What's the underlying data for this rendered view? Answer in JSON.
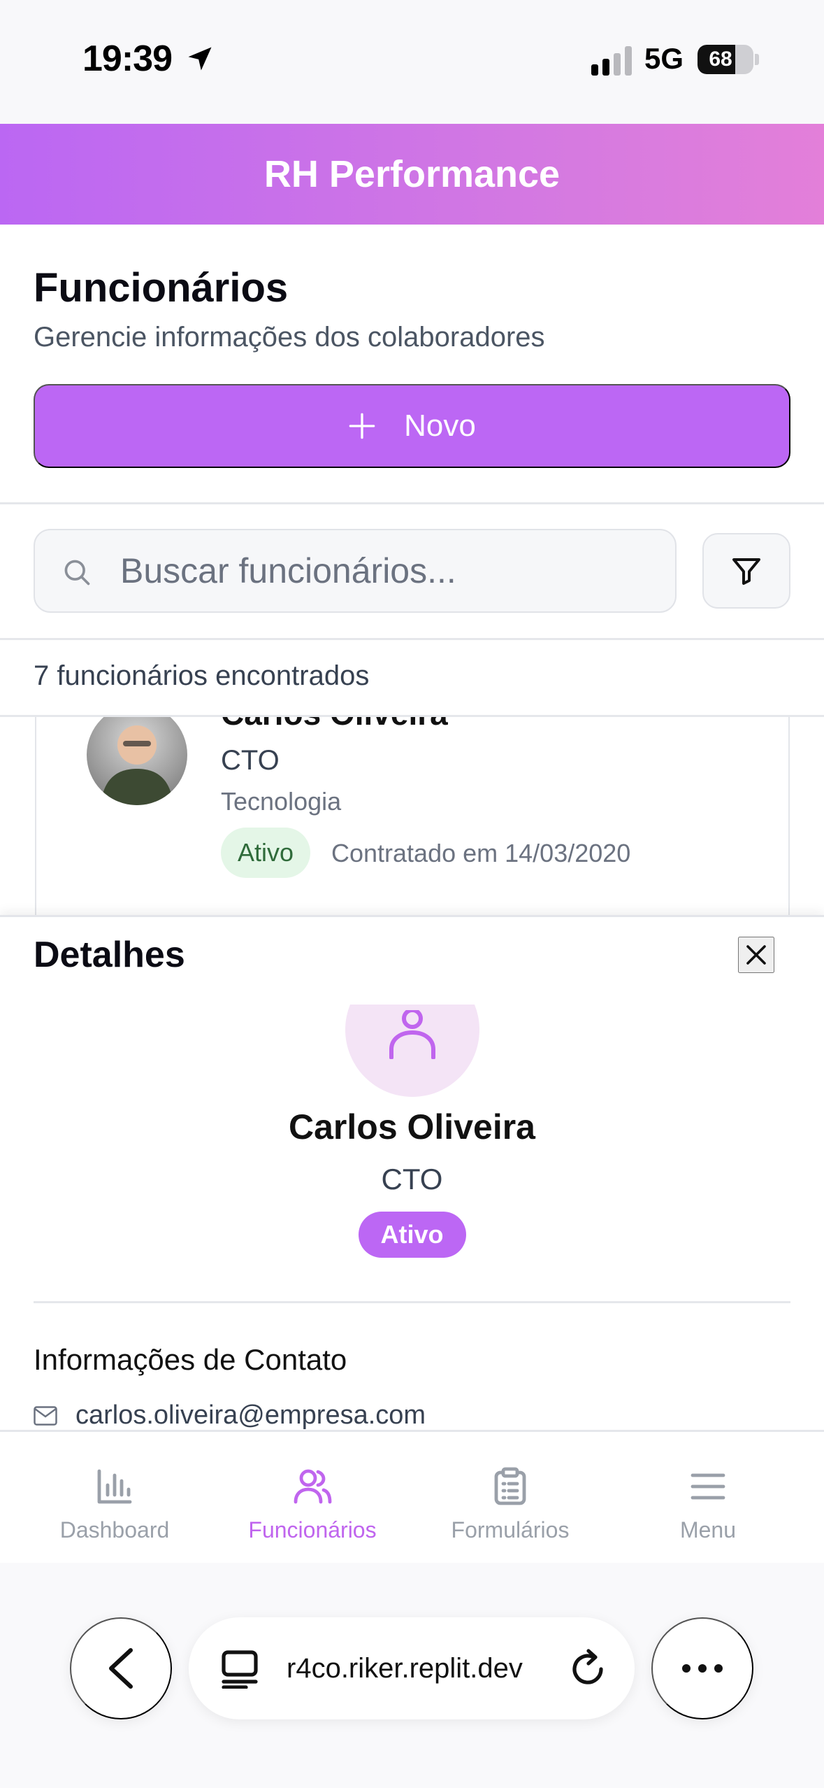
{
  "status_bar": {
    "time": "19:39",
    "network": "5G",
    "battery": "68",
    "battery_level": 0.68
  },
  "app": {
    "title": "RH Performance"
  },
  "page": {
    "title": "Funcionários",
    "subtitle": "Gerencie informações dos colaboradores",
    "new_button_label": "Novo"
  },
  "search": {
    "placeholder": "Buscar funcionários..."
  },
  "results": {
    "count_text": "7 funcionários encontrados"
  },
  "employee_card": {
    "name": "Carlos Oliveira",
    "role": "CTO",
    "department": "Tecnologia",
    "status": "Ativo",
    "hired": "Contratado em 14/03/2020"
  },
  "details": {
    "title": "Detalhes",
    "name": "Carlos Oliveira",
    "role": "CTO",
    "status": "Ativo",
    "contact_heading": "Informações de Contato",
    "email": "carlos.oliveira@empresa.com"
  },
  "tabs": [
    {
      "label": "Dashboard",
      "icon": "bar-chart-icon",
      "active": false
    },
    {
      "label": "Funcionários",
      "icon": "users-icon",
      "active": true
    },
    {
      "label": "Formulários",
      "icon": "clipboard-icon",
      "active": false
    },
    {
      "label": "Menu",
      "icon": "menu-icon",
      "active": false
    }
  ],
  "browser": {
    "url": "r4co.riker.replit.dev"
  },
  "colors": {
    "accent": "#bc67f4",
    "header_gradient_start": "#bb67f3",
    "header_gradient_end": "#e37fd9",
    "active_badge_bg": "#e4f6e7",
    "active_badge_text": "#2f6b3a",
    "tab_active": "#c065ee",
    "tab_inactive": "#9aa0a9"
  }
}
